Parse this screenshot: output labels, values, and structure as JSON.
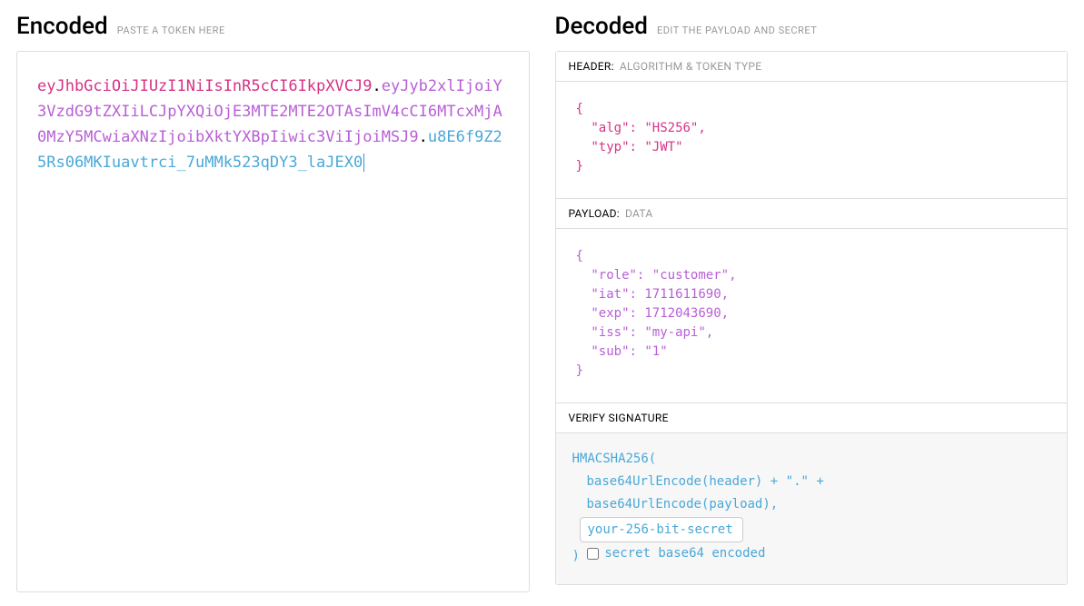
{
  "encoded": {
    "title": "Encoded",
    "subtitle": "PASTE A TOKEN HERE",
    "token_header": "eyJhbGciOiJIUzI1NiIsInR5cCI6IkpXVCJ9",
    "token_payload": "eyJyb2xlIjoiY3VzdG9tZXIiLCJpYXQiOjE3MTE2MTE2OTAsImV4cCI6MTcxMjA0MzY5MCwiaXNzIjoibXktYXBpIiwic3ViIjoiMSJ9",
    "token_signature": "u8E6f9Z25Rs06MKIuavtrci_7uMMk523qDY3_laJEX0",
    "dot": "."
  },
  "decoded": {
    "title": "Decoded",
    "subtitle": "EDIT THE PAYLOAD AND SECRET",
    "header_section": {
      "label": "HEADER:",
      "hint": "ALGORITHM & TOKEN TYPE",
      "json": "{\n  \"alg\": \"HS256\",\n  \"typ\": \"JWT\"\n}"
    },
    "payload_section": {
      "label": "PAYLOAD:",
      "hint": "DATA",
      "json": "{\n  \"role\": \"customer\",\n  \"iat\": 1711611690,\n  \"exp\": 1712043690,\n  \"iss\": \"my-api\",\n  \"sub\": \"1\"\n}"
    },
    "signature_section": {
      "label": "VERIFY SIGNATURE",
      "line1": "HMACSHA256(",
      "line2": "base64UrlEncode(header) + \".\" +",
      "line3": "base64UrlEncode(payload),",
      "secret_value": "your-256-bit-secret",
      "close_paren": ")",
      "checkbox_label": "secret base64 encoded",
      "checkbox_checked": false
    }
  }
}
